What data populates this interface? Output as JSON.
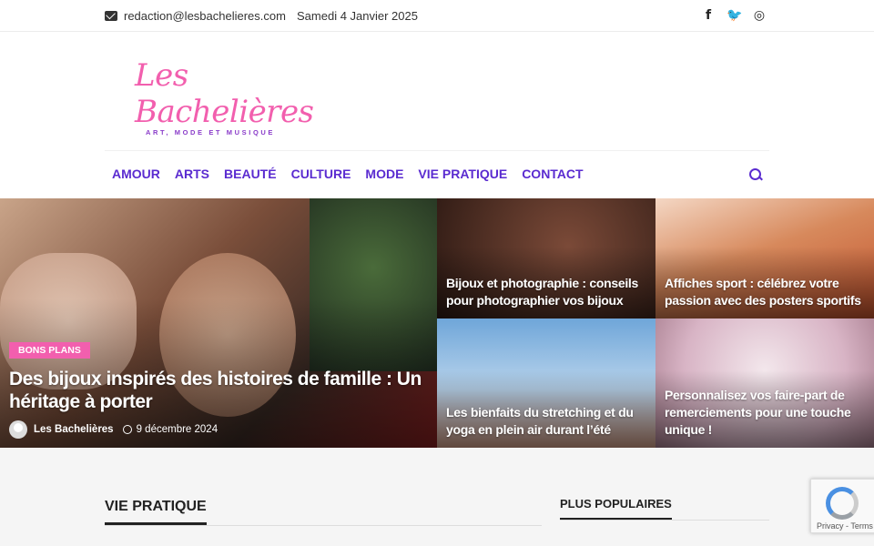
{
  "topbar": {
    "email": "redaction@lesbachelieres.com",
    "date": "Samedi 4 Janvier 2025",
    "social": [
      "facebook-icon",
      "twitter-icon",
      "instagram-icon"
    ],
    "social_glyphs": [
      "f",
      "🐦",
      "◎"
    ]
  },
  "logo": {
    "name": "Les Bachelières",
    "tagline": "ART, MODE ET MUSIQUE"
  },
  "nav": {
    "items": [
      "AMOUR",
      "ARTS",
      "BEAUTÉ",
      "CULTURE",
      "MODE",
      "VIE PRATIQUE",
      "CONTACT"
    ]
  },
  "hero": {
    "main": {
      "badge": "BONS PLANS",
      "title": "Des bijoux inspirés des histoires de famille : Un héritage à porter",
      "author": "Les Bachelières",
      "date": "9 décembre 2024"
    },
    "tiles": [
      {
        "title": "Bijoux et photographie : conseils pour photographier vos bijoux"
      },
      {
        "title": "Affiches sport : célébrez votre passion avec des posters sportifs"
      },
      {
        "title": "Les bienfaits du stretching et du yoga en plein air durant l’été"
      },
      {
        "title": "Personnalisez vos faire-part de remerciements pour une touche unique !"
      }
    ]
  },
  "sections": {
    "main_title": "VIE PRATIQUE",
    "sidebar_title": "PLUS POPULAIRES"
  },
  "recaptcha": {
    "text": "Privacy - Terms"
  },
  "colors": {
    "accent": "#5a2bd0",
    "brand_pink": "#f25fae"
  }
}
